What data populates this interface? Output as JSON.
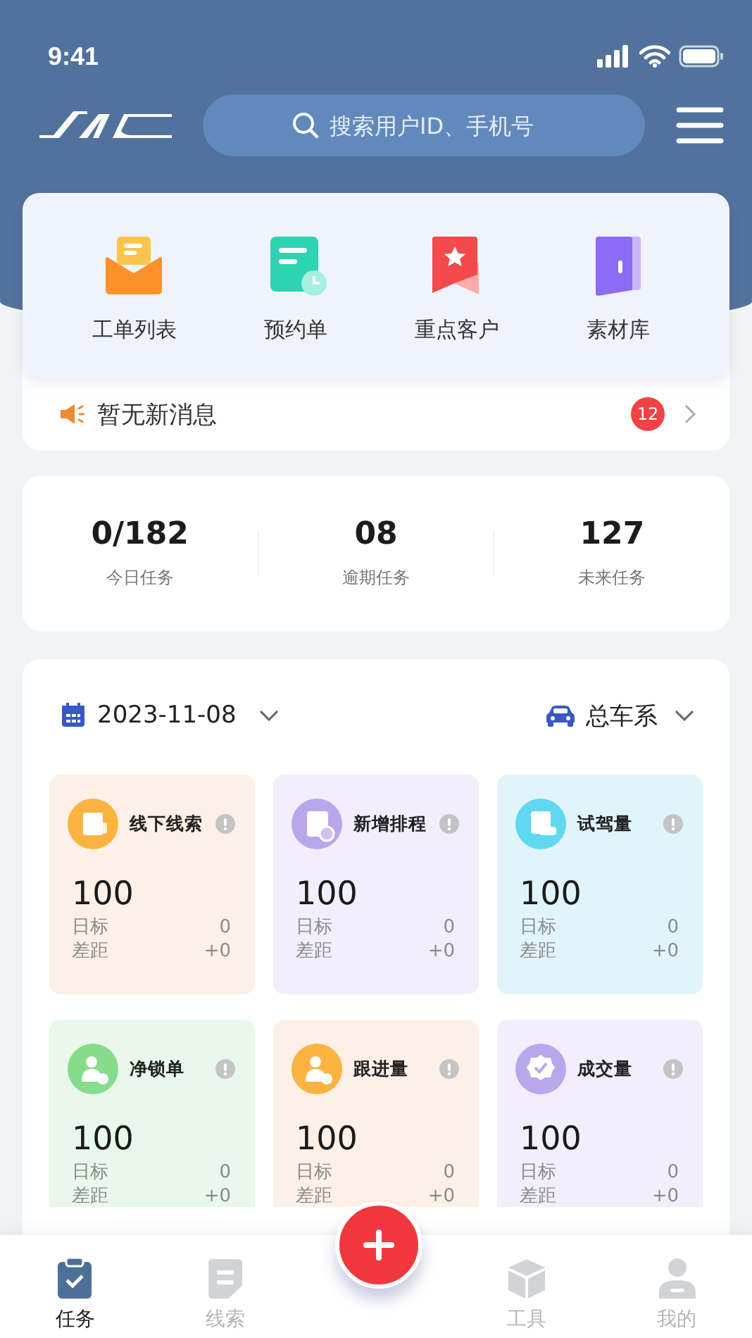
{
  "status_bar": {
    "time": "9:41"
  },
  "header": {
    "search": {
      "placeholder": "搜索用户ID、手机号"
    }
  },
  "quick_actions": [
    {
      "label": "工单列表"
    },
    {
      "label": "预约单"
    },
    {
      "label": "重点客户"
    },
    {
      "label": "素材库"
    }
  ],
  "notice": {
    "text": "暂无新消息",
    "badge": "12"
  },
  "stats": [
    {
      "value": "0/182",
      "label": "今日任务"
    },
    {
      "value": "08",
      "label": "逾期任务"
    },
    {
      "value": "127",
      "label": "未来任务"
    }
  ],
  "filters": {
    "date": "2023-11-08",
    "series": "总车系"
  },
  "metrics": [
    {
      "title": "线下线索",
      "value": "100",
      "target_label": "日标",
      "target": "0",
      "gap_label": "差距",
      "gap": "+0",
      "color": "#fdf0e7"
    },
    {
      "title": "新增排程",
      "value": "100",
      "target_label": "日标",
      "target": "0",
      "gap_label": "差距",
      "gap": "+0",
      "color": "#f2eefc"
    },
    {
      "title": "试驾量",
      "value": "100",
      "target_label": "日标",
      "target": "0",
      "gap_label": "差距",
      "gap": "+0",
      "color": "#e2f4fb"
    },
    {
      "title": "净锁单",
      "value": "100",
      "target_label": "日标",
      "target": "0",
      "gap_label": "差距",
      "gap": "+0",
      "color": "#e8f8ea"
    },
    {
      "title": "跟进量",
      "value": "100",
      "target_label": "日标",
      "target": "0",
      "gap_label": "差距",
      "gap": "+0",
      "color": "#fdf0e7"
    },
    {
      "title": "成交量",
      "value": "100",
      "target_label": "日标",
      "target": "0",
      "gap_label": "差距",
      "gap": "+0",
      "color": "#f2eefc"
    }
  ],
  "tab_bar": [
    {
      "label": "任务",
      "selected": true
    },
    {
      "label": "线索",
      "selected": false
    },
    {
      "label": "工具",
      "selected": false
    },
    {
      "label": "我的",
      "selected": false
    }
  ]
}
